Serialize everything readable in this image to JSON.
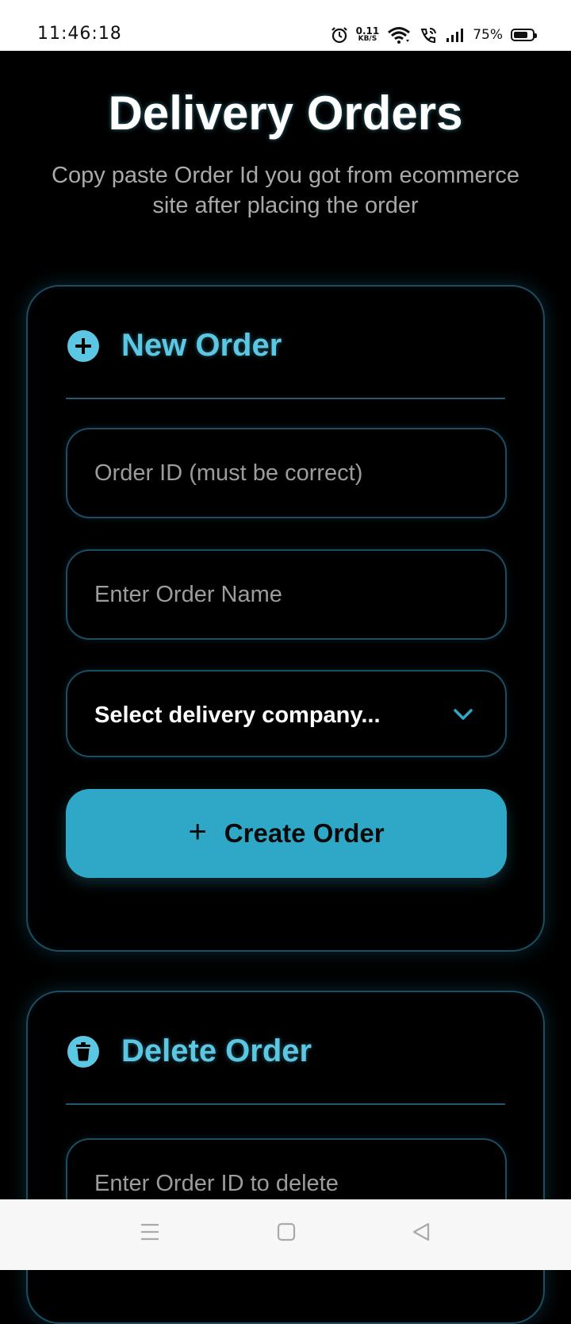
{
  "status_bar": {
    "time": "11:46:18",
    "net_speed_value": "0.11",
    "net_speed_unit": "KB/S",
    "battery_percent": "75%",
    "battery_level": 0.75
  },
  "header": {
    "title": "Delivery Orders",
    "subtitle": "Copy paste Order Id you got from ecommerce site after placing the order"
  },
  "new_order": {
    "title": "New Order",
    "order_id_placeholder": "Order ID (must be correct)",
    "order_name_placeholder": "Enter Order Name",
    "delivery_company_selected": "Select delivery company...",
    "create_button_label": "Create Order",
    "create_button_icon": "plus-icon"
  },
  "delete_order": {
    "title": "Delete Order",
    "order_id_placeholder": "Enter Order ID to delete"
  },
  "nav": {
    "icons": [
      "menu-icon",
      "home-square-icon",
      "back-triangle-icon"
    ]
  },
  "colors": {
    "background": "#000000",
    "accent": "#5cc7e3",
    "button": "#2ea8c6",
    "border": "#1c4d62",
    "subtitle": "#a9a9a9"
  }
}
